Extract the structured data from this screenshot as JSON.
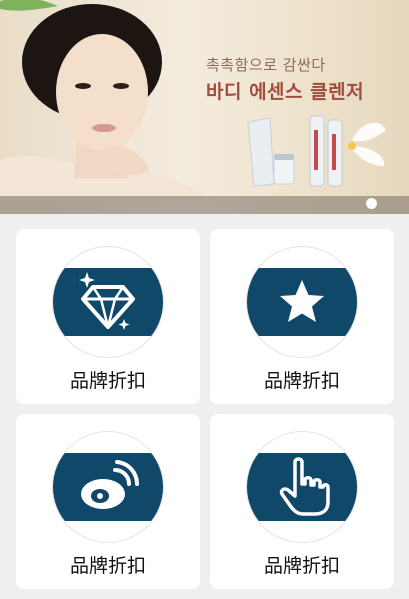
{
  "banner": {
    "headline_line1": "촉촉함으로 감싼다",
    "headline_line2": "바디 에센스 클렌저",
    "indicator_count": 1,
    "active_index": 0
  },
  "colors": {
    "badge_band": "#0f4868",
    "card_bg": "#ffffff",
    "page_bg": "#efefef"
  },
  "cards": [
    {
      "label": "品牌折扣",
      "icon": "diamond-icon"
    },
    {
      "label": "品牌折扣",
      "icon": "star-icon"
    },
    {
      "label": "品牌折扣",
      "icon": "weibo-icon"
    },
    {
      "label": "品牌折扣",
      "icon": "hand-pointer-icon"
    }
  ]
}
